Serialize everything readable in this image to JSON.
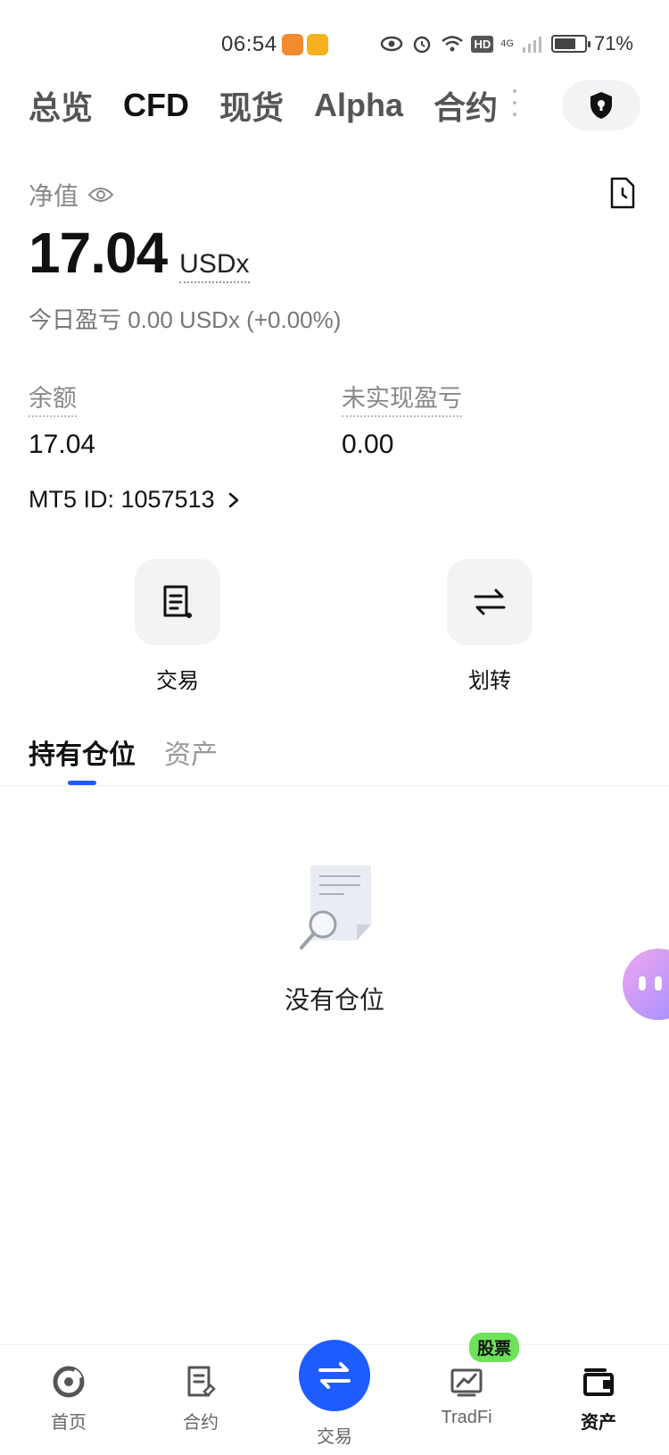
{
  "status_bar": {
    "time": "06:54",
    "battery_percent": "71%",
    "battery_level": 0.71,
    "hd_label": "HD",
    "network_label": "4G"
  },
  "top_tabs": {
    "items": [
      {
        "label": "总览",
        "active": false
      },
      {
        "label": "CFD",
        "active": true
      },
      {
        "label": "现货",
        "active": false
      },
      {
        "label": "Alpha",
        "active": false
      },
      {
        "label": "合约",
        "active": false
      }
    ]
  },
  "account": {
    "net_label": "净值",
    "net_value": "17.04",
    "net_currency": "USDx",
    "pnl_today": "今日盈亏 0.00 USDx (+0.00%)",
    "balance_label": "余额",
    "balance_value": "17.04",
    "unrealized_label": "未实现盈亏",
    "unrealized_value": "0.00",
    "mt5_id": "MT5 ID: 1057513"
  },
  "actions": {
    "trade_label": "交易",
    "transfer_label": "划转"
  },
  "section_tabs": {
    "positions_label": "持有仓位",
    "assets_label": "资产"
  },
  "empty_state": {
    "text": "没有仓位"
  },
  "bottom_nav": {
    "home_label": "首页",
    "futures_label": "合约",
    "trade_label": "交易",
    "tradfi_label": "TradFi",
    "tradfi_badge": "股票",
    "assets_label": "资产"
  },
  "colors": {
    "accent": "#1e5cff",
    "badge_green": "#6ee35a"
  },
  "icons": [
    "eye-icon",
    "shield-lock-icon",
    "history-icon",
    "chevron-right-icon",
    "order-list-icon",
    "transfer-arrows-icon",
    "document-search-icon",
    "home-icon",
    "futures-icon",
    "trade-swap-icon",
    "tradfi-chart-icon",
    "wallet-icon"
  ]
}
